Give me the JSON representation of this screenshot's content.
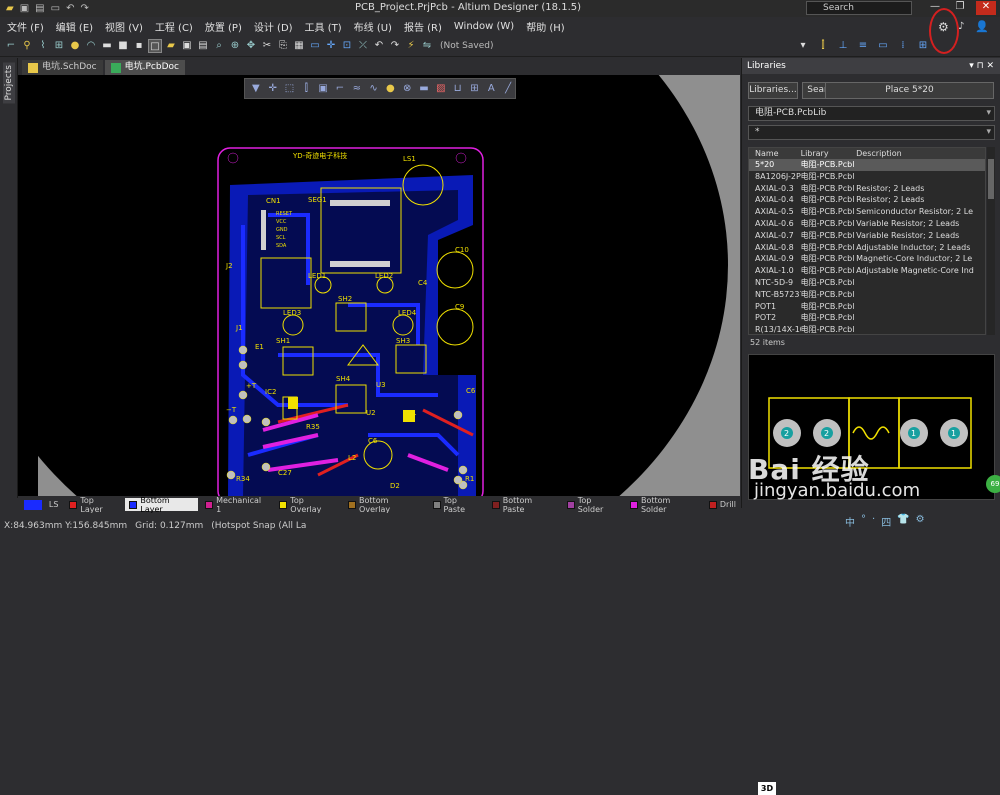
{
  "app": {
    "title": "PCB_Project.PrjPcb - Altium Designer (18.1.5)",
    "search_placeholder": "Search"
  },
  "menu": [
    "文件 (F)",
    "编辑 (E)",
    "视图 (V)",
    "工程 (C)",
    "放置 (P)",
    "设计 (D)",
    "工具 (T)",
    "布线 (U)",
    "报告 (R)",
    "Window (W)",
    "帮助 (H)"
  ],
  "toolbar": {
    "status": "(Not Saved)"
  },
  "left_panel_tab": "Projects",
  "doc_tabs": [
    {
      "label": "电坑.SchDoc",
      "active": false
    },
    {
      "label": "电坑.PcbDoc",
      "active": true
    }
  ],
  "pcb": {
    "title_silk": "YD-奇迹电子科技",
    "labels": [
      "CN1",
      "RESET",
      "VCC",
      "GND",
      "SCL",
      "SDA",
      "SEG1",
      "LS1",
      "C10",
      "J2",
      "LED1",
      "LED2",
      "SH2",
      "C9",
      "C4",
      "LED3",
      "LED4",
      "J1",
      "E1",
      "SH1",
      "SH3",
      "SH4",
      "IC2",
      "U3",
      "U2",
      "C6",
      "R35",
      "C27",
      "C5",
      "L2",
      "R34",
      "D2",
      "R1",
      "C7",
      "T1",
      "+T",
      "−T"
    ]
  },
  "layers": [
    {
      "name": "LS",
      "color": "#1a2bff"
    },
    {
      "name": "Top Layer",
      "color": "#e02020"
    },
    {
      "name": "Bottom Layer",
      "color": "#1a2bff",
      "active": true
    },
    {
      "name": "Mechanical 1",
      "color": "#d02090"
    },
    {
      "name": "Top Overlay",
      "color": "#f0e000"
    },
    {
      "name": "Bottom Overlay",
      "color": "#a07020"
    },
    {
      "name": "Top Paste",
      "color": "#808080"
    },
    {
      "name": "Bottom Paste",
      "color": "#802020"
    },
    {
      "name": "Top Solder",
      "color": "#a040a0"
    },
    {
      "name": "Bottom Solder",
      "color": "#e020e0"
    },
    {
      "name": "Drill",
      "color": "#c02020"
    }
  ],
  "status": {
    "coords": "X:84.963mm Y:156.845mm",
    "grid": "Grid: 0.127mm",
    "snap": "(Hotspot Snap (All La"
  },
  "libraries": {
    "title": "Libraries",
    "btn_libraries": "Libraries...",
    "btn_search": "Search...",
    "btn_place": "Place 5*20",
    "library": "电阻-PCB.PcbLib",
    "filter": "*",
    "columns": [
      "Name",
      "Library",
      "Description"
    ],
    "rows": [
      [
        "5*20",
        "电阻-PCB.Pcbl",
        ""
      ],
      [
        "8A1206J-2P",
        "电阻-PCB.Pcbl",
        ""
      ],
      [
        "AXIAL-0.3",
        "电阻-PCB.Pcbl",
        "Resistor; 2 Leads"
      ],
      [
        "AXIAL-0.4",
        "电阻-PCB.Pcbl",
        "Resistor; 2 Leads"
      ],
      [
        "AXIAL-0.5",
        "电阻-PCB.Pcbl",
        "Semiconductor Resistor; 2 Le"
      ],
      [
        "AXIAL-0.6",
        "电阻-PCB.Pcbl",
        "Variable Resistor; 2 Leads"
      ],
      [
        "AXIAL-0.7",
        "电阻-PCB.Pcbl",
        "Variable Resistor; 2 Leads"
      ],
      [
        "AXIAL-0.8",
        "电阻-PCB.Pcbl",
        "Adjustable Inductor; 2 Leads"
      ],
      [
        "AXIAL-0.9",
        "电阻-PCB.Pcbl",
        "Magnetic-Core Inductor; 2 Le"
      ],
      [
        "AXIAL-1.0",
        "电阻-PCB.Pcbl",
        "Adjustable Magnetic-Core Ind"
      ],
      [
        "NTC-5D-9",
        "电阻-PCB.Pcbl",
        ""
      ],
      [
        "NTC-B57237-",
        "电阻-PCB.Pcbl",
        ""
      ],
      [
        "POT1",
        "电阻-PCB.Pcbl",
        ""
      ],
      [
        "POT2",
        "电阻-PCB.Pcbl",
        ""
      ],
      [
        "R(13/14X-10M",
        "电阻-PCB.Pcbl",
        ""
      ]
    ],
    "count": "52 items",
    "btn_3d": "3D",
    "pad_labels": [
      "2",
      "2",
      "1",
      "1"
    ]
  },
  "watermark": {
    "brand": "Bai 经验",
    "url": "jingyan.baidu.com",
    "badge": "69"
  },
  "tray": [
    "中",
    "°",
    "·",
    "四",
    "👕",
    "⚙"
  ]
}
